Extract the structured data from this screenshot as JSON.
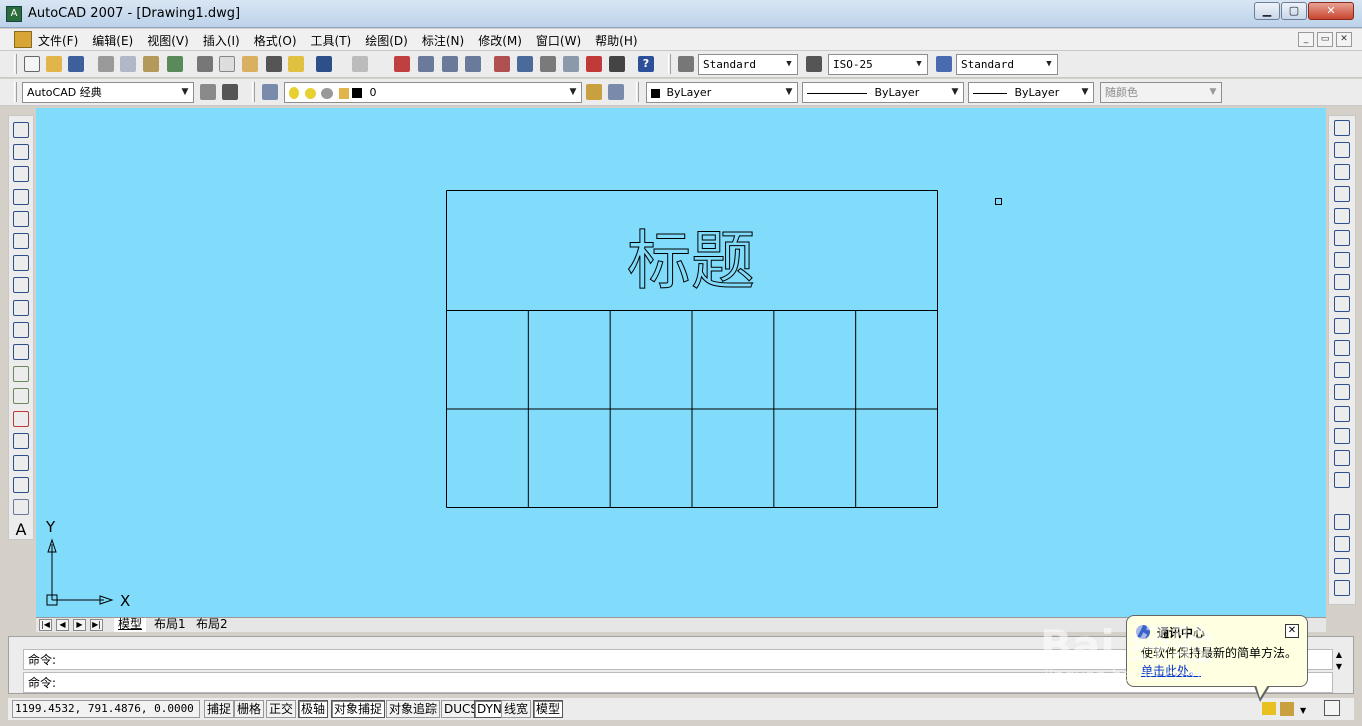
{
  "window": {
    "title": "AutoCAD 2007 - [Drawing1.dwg]",
    "min_label": "▁",
    "max_label": "▢",
    "close_label": "✕"
  },
  "menu": [
    "文件(F)",
    "编辑(E)",
    "视图(V)",
    "插入(I)",
    "格式(O)",
    "工具(T)",
    "绘图(D)",
    "标注(N)",
    "修改(M)",
    "窗口(W)",
    "帮助(H)"
  ],
  "mdi": [
    "_",
    "▭",
    "✕"
  ],
  "toolbar1": {
    "text_style": "Standard",
    "dim_style": "ISO-25",
    "table_style": "Standard"
  },
  "toolbar2": {
    "workspace": "AutoCAD 经典",
    "layer": "0",
    "color": "ByLayer",
    "linetype": "ByLayer",
    "lineweight": "ByLayer",
    "plotstyle": "随颜色"
  },
  "drawing": {
    "title_cell_text": "标题",
    "table_columns": 6,
    "table_rows_below_title": 2,
    "ucs_x_label": "X",
    "ucs_y_label": "Y"
  },
  "tabs": {
    "nav": [
      "|◀",
      "◀",
      "▶",
      "▶|"
    ],
    "items": [
      "模型",
      "布局1",
      "布局2"
    ],
    "active": "模型"
  },
  "command": {
    "line1": "命令:",
    "line2": "命令:"
  },
  "status": {
    "coords": "1199.4532, 791.4876, 0.0000",
    "buttons": [
      {
        "label": "捕捉",
        "on": false
      },
      {
        "label": "栅格",
        "on": false
      },
      {
        "label": "正交",
        "on": false
      },
      {
        "label": "极轴",
        "on": true
      },
      {
        "label": "对象捕捉",
        "on": true
      },
      {
        "label": "对象追踪",
        "on": false
      },
      {
        "label": "DUCS",
        "on": false
      },
      {
        "label": "DYN",
        "on": true
      },
      {
        "label": "线宽",
        "on": false
      },
      {
        "label": "模型",
        "on": true
      }
    ]
  },
  "balloon": {
    "title": "通讯中心",
    "body": "使软件保持最新的简单方法。",
    "link": "单击此处。",
    "close": "✕"
  },
  "watermark": {
    "main": "Bai 经验",
    "sub": "jingyan.baidu.com"
  },
  "colors": {
    "canvas": "#80dcfa",
    "lines": "#000000",
    "balloon": "#ffffe1"
  }
}
